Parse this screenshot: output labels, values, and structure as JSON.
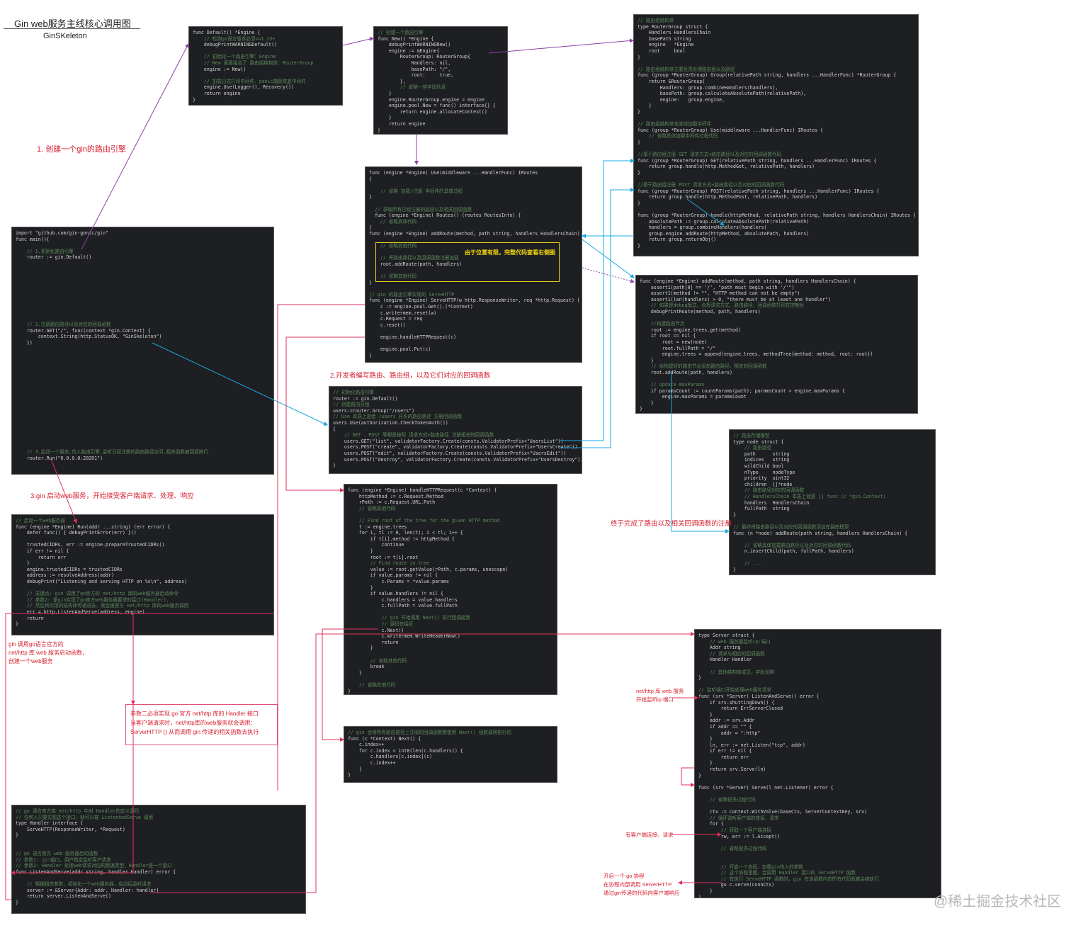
{
  "header": {
    "title": "Gin web服务主线核心调用图",
    "subtitle": "GinSKeleton"
  },
  "notes": {
    "step1": "1. 创建一个gin的路由引擎",
    "step2": "2.开发者编写路由、路由组，以及它们对应的回调函数",
    "step3": "3.gin 启动web服务，开始接受客户端请求、处理、响应",
    "route_done": "终于完成了路由以及相关回调函数的注册",
    "gin_listen": "gin 调用go语言官方的\nnet/http 库 web 服务启动函数，\n创建一个web服务",
    "handler_note": "参数二必须实现 go 官方 net/http 库的 Handler 接口\n当客户端请求时，net/http库的web服务就会调用：\nServerHTTP () 从而调用 gin 传递的相关函数去执行",
    "net_http_start": "net/http 库 web 服务\n开始监听ip:端口",
    "client_conn": "有客户端连接、请求",
    "goroutine": "开启一个 go 协程\n在协程内部调用 ServerHTTP\n通过gin传递的代码向客户端响应",
    "highlight": "由于位置有限，完整代码查看右侧图"
  },
  "watermark": "@稀土掘金技术社区",
  "code_blocks": {
    "main": [
      "import \"github.com/gin-gonic/gin\"",
      "func main(){",
      "",
      "    // 1.初始化路由引擎",
      "    router := gin.Default()",
      "",
      "",
      "",
      "",
      "",
      "",
      "",
      "",
      "",
      "",
      "    // 2.注册路由路径以及对应的回调函数",
      "    router.GET(\"/\", func(context *gin.Context) {",
      "        context.String(http.StatusOK, \"GinSkeleton\")",
      "    })",
      "",
      "",
      "",
      "",
      "",
      "",
      "",
      "",
      "",
      "",
      "",
      "",
      "",
      "",
      "",
      "",
      "",
      "    // 3.启动一个服务,传入路由引擎,监听已经注册的路由路径访问,相关函数被回调执行",
      "    router.Run(\"0.0.0.0:20201\")",
      "",
      "",
      "}"
    ],
    "default": [
      "func Default() *Engine {",
      "    // 检测go语言版本必须>=1.13+",
      "    debugPrintWARNINGDefault()",
      "",
      "    // 初始化一个路由引擎：Engine",
      "    // New 里面组合了 路由组结构体：RouterGroup",
      "    engine := New()",
      "",
      "    // 加载日志打印中间件、panic捕获恢复中间件",
      "    engine.Use(Logger(), Recovery())",
      "    return engine",
      "}"
    ],
    "new": [
      "// 创建一个路由引擎",
      "func New() *Engine {",
      "    debugPrintWARNINGNew()",
      "    engine := &Engine{",
      "        RouterGroup: RouterGroup{",
      "            Handlers: nil,",
      "            basePath: \"/\",",
      "            root:     true,",
      "        },",
      "        // 省略一些字段信息",
      "    }",
      "    engine.RouterGroup.engine = engine",
      "    engine.pool.New = func() interface{} {",
      "        return engine.allocateContext()",
      "    }",
      "    return engine",
      "}"
    ],
    "router_group": [
      "// 路由组结构体",
      "type RouterGroup struct {",
      "    Handlers HandlersChain",
      "    basePath string",
      "    engine   *Engine",
      "    root     bool",
      "}",
      "",
      "// 路由组结构体主要负责处理路由组以及路径",
      "func (group *RouterGroup) Group(relativePath string, handlers ...HandlerFunc) *RouterGroup {",
      "    return &RouterGroup{",
      "        Handlers: group.combineHandlers(handlers),",
      "        basePath: group.calculateAbsolutePath(relativePath),",
      "        engine:   group.engine,",
      "    }",
      "}",
      "",
      "// 路由组结构体也支持加载中间件",
      "func (group *RouterGroup) Use(middleware ...HandlerFunc) IRoutes {",
      "    // 省略具体加载中间件过程代码",
      "}",
      "",
      "//基于路由组注册 GET 请求方式+路由路径以及对应的回调函数代码",
      "func (group *RouterGroup) GET(relativePath string, handlers ...HandlerFunc) IRoutes {",
      "    return group.handle(http.MethodGet, relativePath, handlers)",
      "}",
      "",
      "//基于路由组注册 POST 请求方式+路由路径以及对应的回调函数代码",
      "func (group *RouterGroup) POST(relativePath string, handlers ...HandlerFunc) IRoutes {",
      "    return group.handle(http.MethodPost, relativePath, handlers)",
      "}",
      "",
      "func (group *RouterGroup) handle(httpMethod, relativePath string, handlers HandlersChain) IRoutes {",
      "    absolutePath := group.calculateAbsolutePath(relativePath)",
      "    handlers = group.combineHandlers(handlers)",
      "    group.engine.addRoute(httpMethod, absolutePath, handlers)",
      "    return group.returnObj()",
      "}"
    ],
    "engine_use": [
      "func (engine *Engine) Use(middleware ...HandlerFunc) IRoutes",
      "{",
      "",
      "    // 省略 加载/注册 中间件的具体过程",
      "}",
      "",
      "  // 获取所有已经注册的路由以及相关回调函数",
      "  func (engine *Engine) Routes() (routes RoutesInfo) {",
      "    // 省略具体代码",
      "}",
      "func (engine *Engine) addRoute(method, path string, handlers HandlersChain) {",
      "",
      "    // 省略其他代码",
      "",
      "    // 将路由路径以及回调函数注册加载",
      "    root.addRoute(path, handlers)",
      "",
      "    // 省略其他代码",
      "}",
      "",
      "// gin 的路由引擎实现的 ServeHTTP",
      "func (engine *Engine) ServeHTTP(w http.ResponseWriter, req *http.Request) {",
      "    c := engine.pool.Get().(*Context)",
      "    c.writermem.reset(w)",
      "    c.Request = req",
      "    c.reset()",
      "",
      "    engine.handleHTTPRequest(c)",
      "",
      "    engine.pool.Put(c)",
      "}"
    ],
    "add_route": [
      "func (engine *Engine) addRoute(method, path string, handlers HandlersChain) {",
      "    assert1(path[0] == '/', \"path must begin with '/'\")",
      "    assert1(method != \"\", \"HTTP method can not be empty\")",
      "    assert1(len(handlers) > 0, \"there must be at least one handler\")",
      "    // 如果是debug模式，会将请求方式、路由路径、回调函数打印在控制台",
      "    debugPrintRoute(method, path, handlers)",
      "",
      "    //构建路由节点",
      "    root := engine.trees.get(method)",
      "    if root == nil {",
      "        root = new(node)",
      "        root.fullPath = \"/\"",
      "        engine.trees = append(engine.trees, methodTree{method: method, root: root})",
      "    }",
      "    // 给构建好的路由节点添加路由路径，相关的回调函数",
      "    root.addRoute(path, handlers)",
      "",
      "    // Update maxParams",
      "    if paramsCount := countParams(path); paramsCount > engine.maxParams {",
      "        engine.maxParams = paramsCount",
      "    }",
      "}"
    ],
    "routes_define": [
      "// 初始化路由引擎",
      "router := gin.Default()",
      "// 创建路由分组",
      "users:=router.Group(\"/users\")",
      "// Use 本质上是给 /users 开头的路由路径 注册回调函数",
      "users.Use(authorization.CheckTokenAuth())",
      "{",
      "    // GET 、POST 等都是按照 请求方式+路由路径 注册相关的回调函数",
      "    users.GET(\"list\", validatorFactory.Create(consts.ValidatorPrefix+\"UsersList\"))",
      "    users.POST(\"create\", validatorFactory.Create(consts.ValidatorPrefix+\"UsersCreate\"))",
      "    users.POST(\"edit\", validatorFactory.Create(consts.ValidatorPrefix+\"UsersEdit\"))",
      "    users.POST(\"destroy\", validatorFactory.Create(consts.ValidatorPrefix+\"UsersDestroy\"))",
      "}"
    ],
    "node": [
      "// 路由存储模型",
      "type node struct {",
      "    // 路由路径",
      "    path      string",
      "    indices   string",
      "    wildChild bool",
      "    nType     nodeType",
      "    priority  uint32",
      "    children  []*node",
      "    // 路由路径对应的回调函数",
      "    // HandlersChain 本质上就是 [] func (c *gin.Context)",
      "    handlers  HandlersChain",
      "    fullPath  string",
      "}",
      "",
      "// 最终将路由路径以及对应的回调函数添加在路由模型",
      "func (n *node) addRoute(path string, handlers HandlersChain) {",
      "",
      "    // 省略具体加载路由路径以及对应的回调函数代码",
      "    n.insertChild(path, fullPath, handlers)",
      "",
      "    // ...",
      "}"
    ],
    "run": [
      "// 启动一个web服务器",
      "func (engine *Engine) Run(addr ...string) (err error) {",
      "    defer func() { debugPrintError(err) }()",
      "",
      "    trustedCIDRs, err := engine.prepareTrustedCIDRs()",
      "    if err != nil {",
      "        return err",
      "    }",
      "    engine.trustedCIDRs = trustedCIDRs",
      "    address := resolveAddress(addr)",
      "    debugPrint(\"Listening and serving HTTP on %s\\n\", address)",
      "",
      "    // 关键点: gin 调用了go官方的 net/http 库的web服务器启动命令",
      "    // 参数2: 是gin实现了go官方web服务器要求的接口(Handler),",
      "    // 然后将实现的结构体传递进去，就会被官方 net/http 库的web服务调用",
      "    err = http.ListenAndServe(address, engine)",
      "    return",
      "}"
    ],
    "handle_http": [
      "func (engine *Engine) handleHTTPRequest(c *Context) {",
      "    httpMethod := c.Request.Method",
      "    rPath := c.Request.URL.Path",
      "    // 省略其他代码",
      "",
      "    // Find root of the tree for the given HTTP method",
      "    t := engine.trees",
      "    for i, tl := 0, len(t); i < tl; i++ {",
      "        if t[i].method != httpMethod {",
      "            continue",
      "        }",
      "        root := t[i].root",
      "        // Find route in tree",
      "        value := root.getValue(rPath, c.params, unescape)",
      "        if value.params != nil {",
      "            c.Params = *value.params",
      "        }",
      "        if value.handlers != nil {",
      "            c.handlers = value.handlers",
      "            c.fullPath = value.fullPath",
      "",
      "            // gin 开始调用 Next() 执行回调函数",
      "            // 源码在接近",
      "            c.Next()",
      "            c.writermem.WriteHeaderNow()",
      "            return",
      "        }",
      "",
      "        // 省略其他代码",
      "        break",
      "    }",
      "",
      "    // 省略其他代码",
      "}"
    ],
    "next": [
      "// gin 会将所有路由路径上注册的回调函数都使用 Next() 函数调用执行的",
      "func (c *Context) Next() {",
      "    c.index++",
      "    for c.index < int8(len(c.handlers)) {",
      "        c.handlers[c.index](c)",
      "        c.index++",
      "    }",
      "}"
    ],
    "server": [
      "type Server struct {",
      "    // web 服务器监听ip:端口",
      "    Addr string",
      "    // 请求与相应的回调函数",
      "    Handler Handler",
      "",
      "    // 其他结构体成员，字段省略",
      "}",
      "",
      "// 监听端口开始处理web服务请求",
      "func (srv *Server) ListenAndServe() error {",
      "    if srv.shuttingDown() {",
      "        return ErrServerClosed",
      "    }",
      "    addr := srv.Addr",
      "    if addr == \"\" {",
      "        addr = \":http\"",
      "    }",
      "    ln, err := net.Listen(\"tcp\", addr)",
      "    if err != nil {",
      "        return err",
      "    }",
      "    return srv.Serve(ln)",
      "}",
      "",
      "func (srv *Server) Serve(l net.Listener) error {",
      "",
      "    // 省略很多过程代码",
      "",
      "    ctx := context.WithValue(baseCtx, ServerContextKey, srv)",
      "    // 循环监听客户端的连接、请求",
      "    for {",
      "        // 获取一个客户端连接",
      "        rw, err := l.Accept()",
      "",
      "        // 省略很多过程代码",
      "",
      "",
      "        // 开启一个协程，加载gin传入的参数",
      "        // 这个协程里面，会调用 Handler 接口的 ServeHTTP 函数",
      "        // 在执行 ServeHTTP 函数时，gin 在该函数内的所有代码就被会被执行",
      "        go c.serve(connCtx)",
      "    }",
      "}"
    ],
    "listen_serve": [
      "// go 语言官方库 net/http 中对 Handler的定义源码",
      "// 任何人只要实现这个接口，就可以被 ListenAndServe 调用",
      "type Handler interface {",
      "    ServeHTTP(ResponseWriter, *Request)",
      "}",
      "",
      "",
      "// go 语言官方 web 服务器启动函数",
      "// 参数1: ip:端口，用户指定监听客户请求",
      "// 参数2: Handler 处理web请求对应的数据类型，Handler是一个接口",
      "func ListenAndServe(addr string, handler Handler) error {",
      "",
      "    // 根据相关参数，初始化一个web服务器，启动后监听请求",
      "    server := &Server{Addr: addr, Handler: handler}",
      "    return server.ListenAndServe()",
      "}"
    ]
  }
}
